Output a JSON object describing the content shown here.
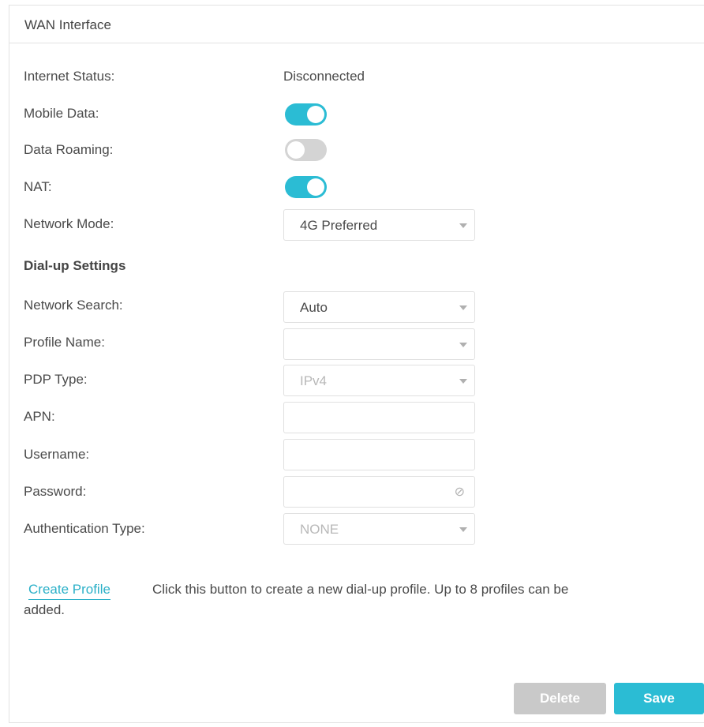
{
  "panel": {
    "title": "WAN Interface"
  },
  "rows": {
    "internet_status": {
      "label": "Internet Status:",
      "value": "Disconnected"
    },
    "mobile_data": {
      "label": "Mobile Data:",
      "on": true
    },
    "data_roaming": {
      "label": "Data Roaming:",
      "on": false
    },
    "nat": {
      "label": "NAT:",
      "on": true
    },
    "network_mode": {
      "label": "Network Mode:",
      "value": "4G Preferred"
    }
  },
  "dialup": {
    "title": "Dial-up Settings",
    "network_search": {
      "label": "Network Search:",
      "value": "Auto"
    },
    "profile_name": {
      "label": "Profile Name:",
      "value": ""
    },
    "pdp_type": {
      "label": "PDP Type:",
      "value": "IPv4"
    },
    "apn": {
      "label": "APN:",
      "value": ""
    },
    "username": {
      "label": "Username:",
      "value": ""
    },
    "password": {
      "label": "Password:",
      "value": "",
      "icon": "eye-off-icon"
    },
    "auth_type": {
      "label": "Authentication Type:",
      "value": "NONE"
    }
  },
  "profile": {
    "create_label": "Create Profile",
    "desc_line1": "Click this button to create a new dial-up profile. Up to 8 profiles can be",
    "desc_line2": "added."
  },
  "buttons": {
    "delete": "Delete",
    "save": "Save"
  },
  "colors": {
    "accent": "#2bbcd4",
    "toggle_off": "#d4d4d4",
    "delete_disabled": "#c9c9c9"
  }
}
